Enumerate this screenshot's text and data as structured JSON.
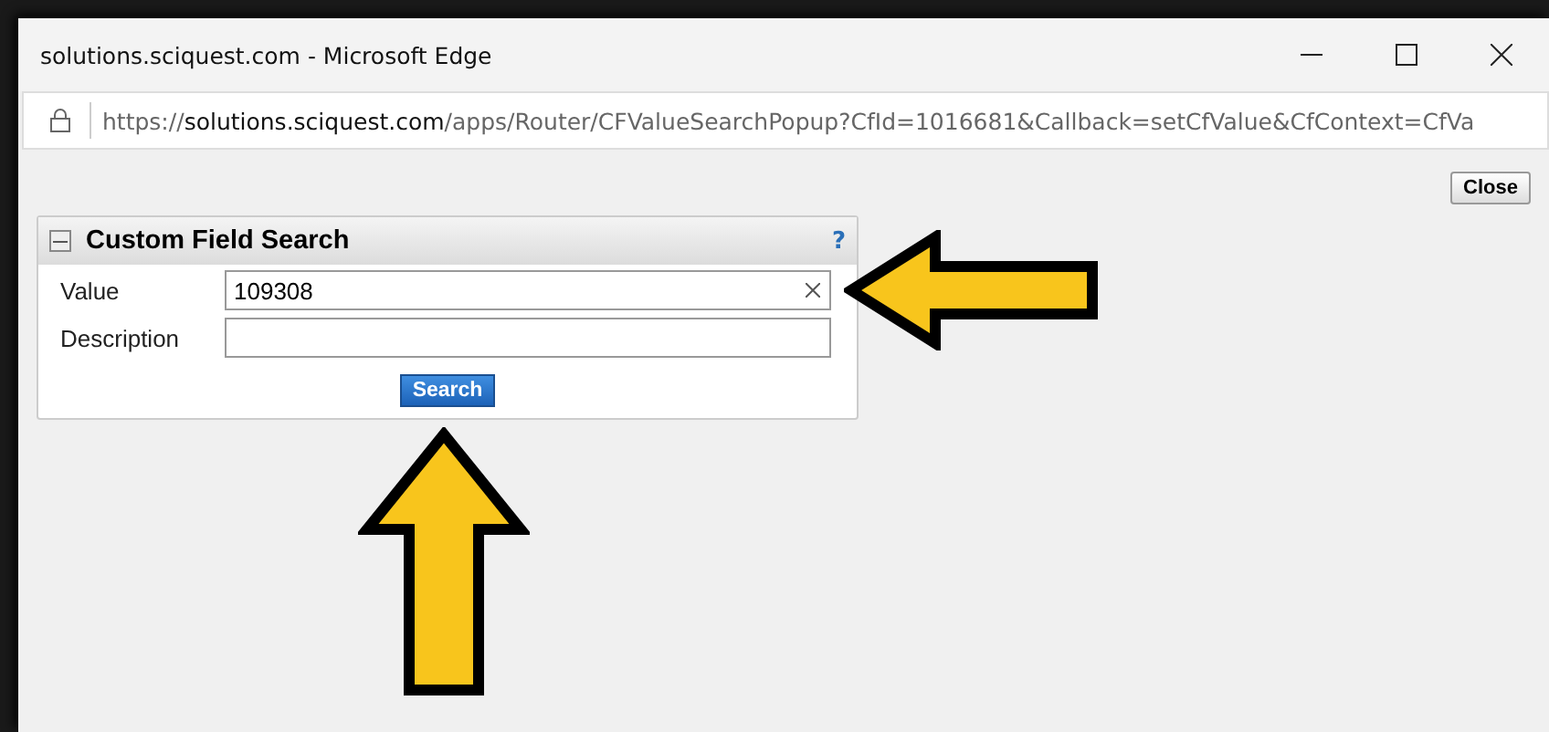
{
  "window": {
    "title": "solutions.sciquest.com - Microsoft Edge"
  },
  "address_bar": {
    "scheme": "https://",
    "host": "solutions.sciquest.com",
    "path": "/apps/Router/CFValueSearchPopup?CfId=1016681&Callback=setCfValue&CfContext=CfVa"
  },
  "close_button": "Close",
  "panel": {
    "title": "Custom Field Search",
    "help": "?",
    "expanded": true,
    "fields": [
      {
        "label": "Value",
        "value": "109308",
        "clearable": true
      },
      {
        "label": "Description",
        "clearable": false
      }
    ],
    "search_button": "Search"
  }
}
